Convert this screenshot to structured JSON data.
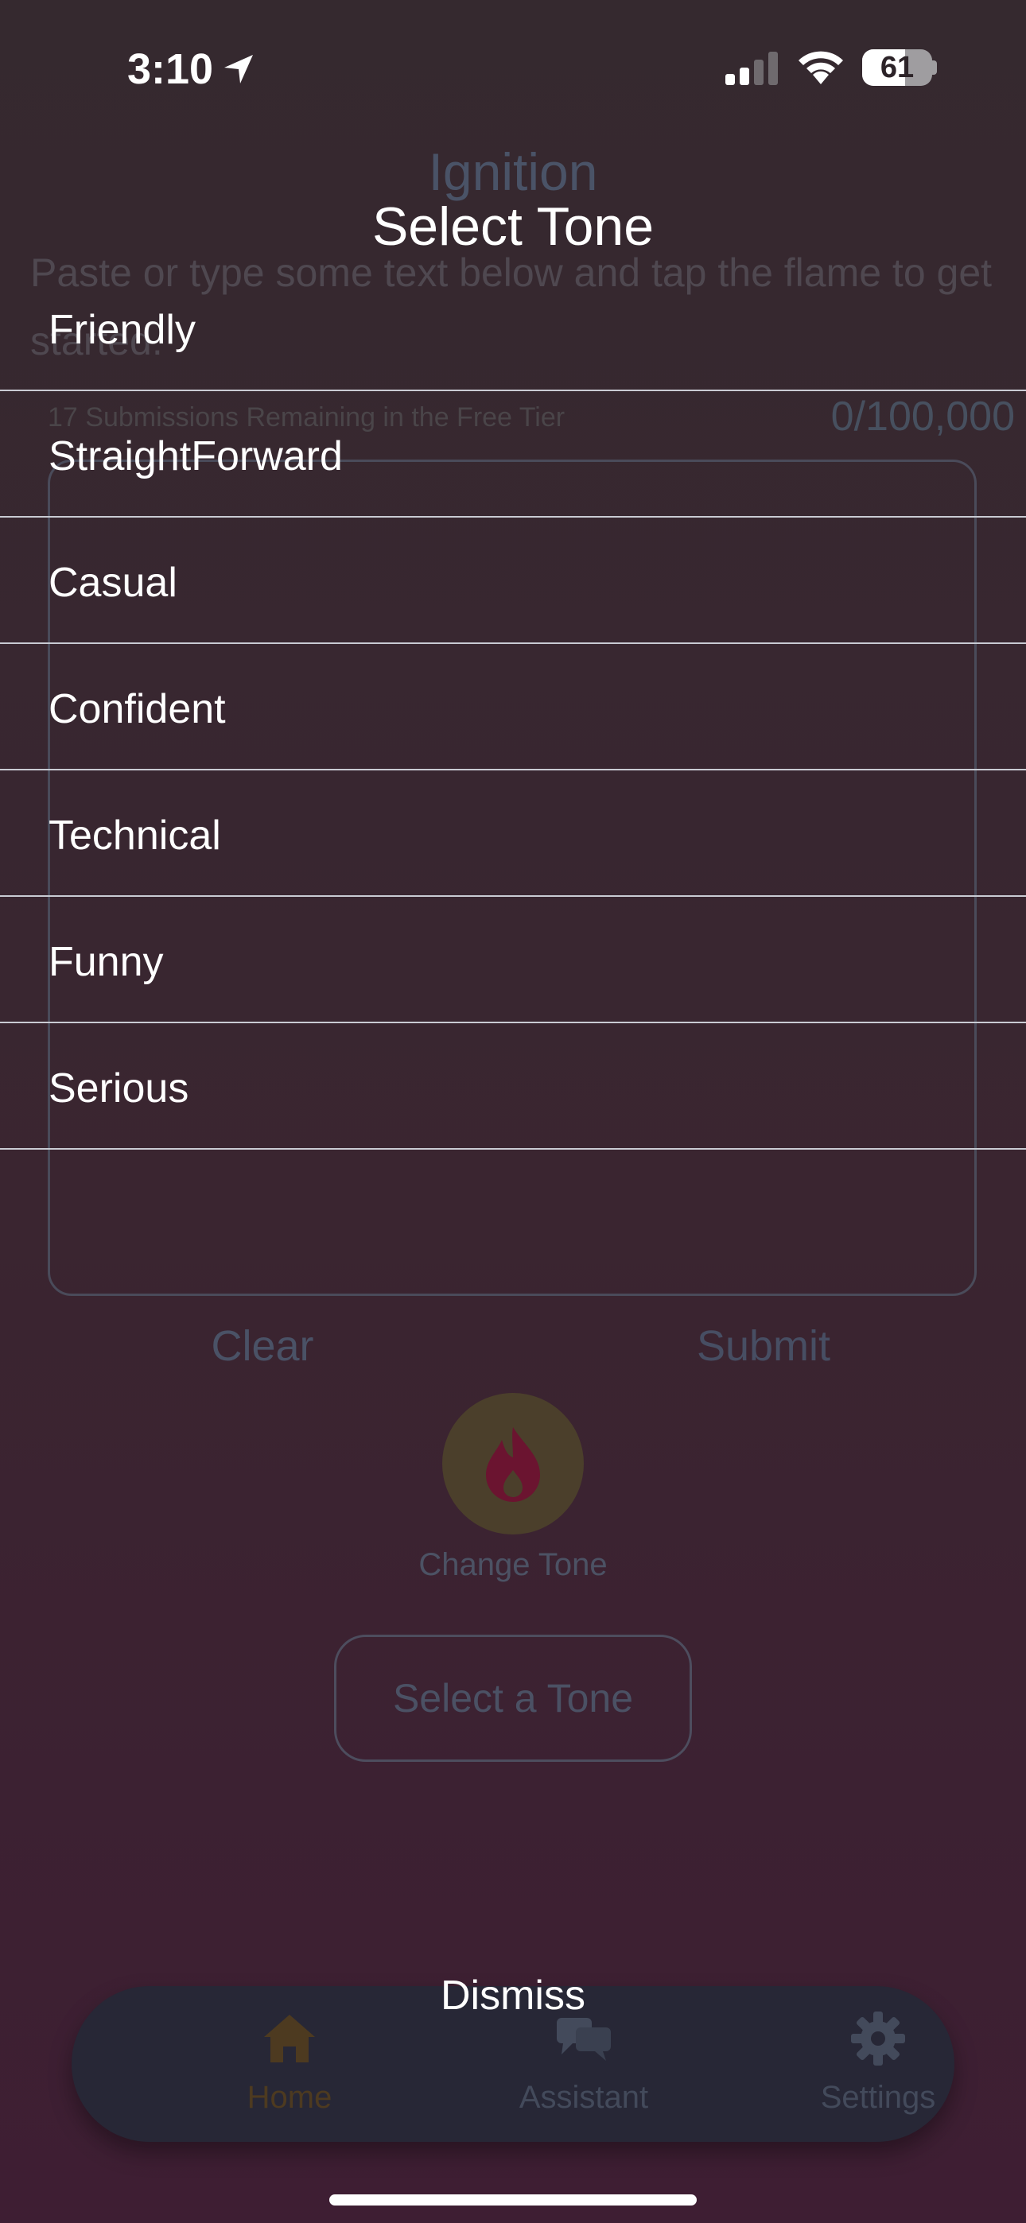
{
  "status": {
    "time": "3:10",
    "battery": "61",
    "battery_level": 0.61
  },
  "app": {
    "title": "Ignition",
    "instructions": "Paste or type some text below and tap the flame to get started.",
    "remaining": "17 Submissions Remaining in the Free Tier",
    "counter": "0/100,000",
    "clear_label": "Clear",
    "submit_label": "Submit",
    "change_tone_label": "Change Tone",
    "select_tone_label": "Select a Tone"
  },
  "tabbar": {
    "home": "Home",
    "assistant": "Assistant",
    "settings": "Settings"
  },
  "picker": {
    "title": "Select Tone",
    "tones": [
      "Friendly",
      "StraightForward",
      "Casual",
      "Confident",
      "Technical",
      "Funny",
      "Serious"
    ],
    "dismiss_label": "Dismiss"
  },
  "colors": {
    "flame_accent": "#6b1430",
    "home_tab_accent": "#4d3a20",
    "divider": "#c9cbd3"
  }
}
